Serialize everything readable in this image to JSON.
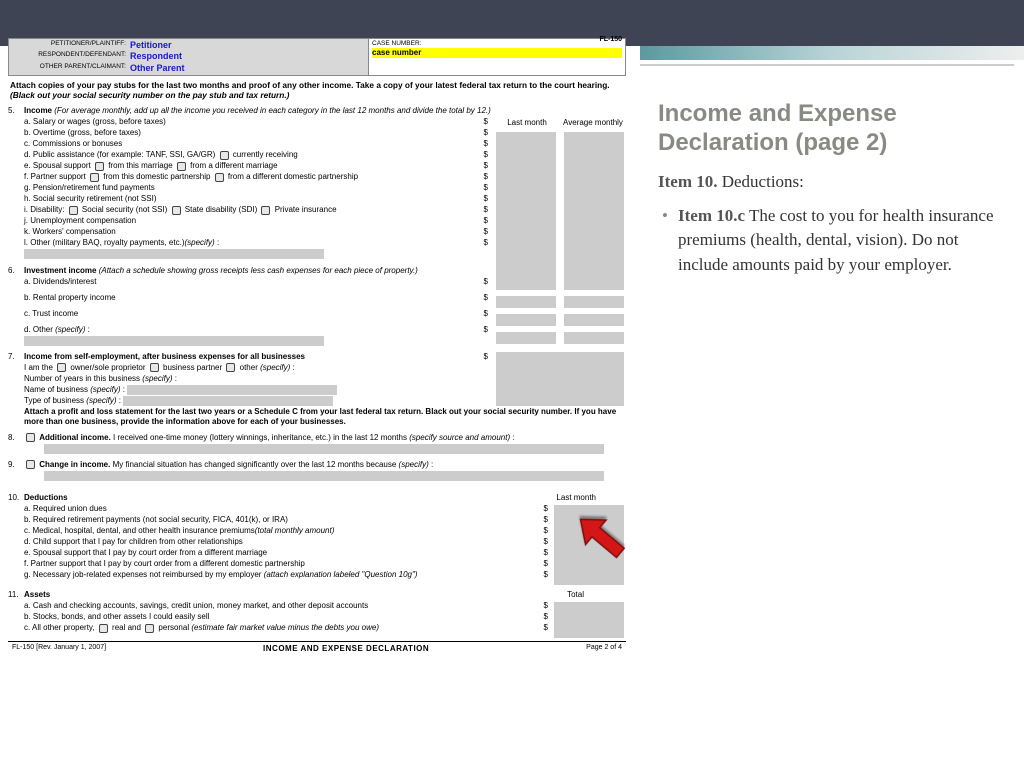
{
  "form_code": "FL-150",
  "header": {
    "pet_label": "PETITIONER/PLAINTIFF:",
    "pet_val": "Petitioner",
    "resp_label": "RESPONDENT/DEFENDANT:",
    "resp_val": "Respondent",
    "other_label": "OTHER PARENT/CLAIMANT:",
    "other_val": "Other Parent",
    "case_label": "CASE NUMBER:",
    "case_val": "case number"
  },
  "instr": "Attach copies of your pay stubs for the last two months and proof of any other income. Take a copy of your latest federal tax return to the court hearing.",
  "instr_em": "(Black out your social security number on the pay stub and tax return.)",
  "col_last": "Last month",
  "col_avg": "Average monthly",
  "s5": {
    "num": "5.",
    "title": "Income",
    "note": "(For average monthly, add up all the income you received in each category in the last 12 months and divide the total by 12.)",
    "a": "a.  Salary or wages (gross, before taxes)",
    "b": "b.  Overtime (gross, before taxes)",
    "c": "c.  Commissions or bonuses",
    "d": "d.  Public assistance (for example: TANF, SSI, GA/GR)",
    "d_opt": "currently receiving",
    "e": "e.  Spousal support",
    "e1": "from this marriage",
    "e2": "from a different marriage",
    "f": "f.   Partner support",
    "f1": "from this domestic partnership",
    "f2": "from a different domestic partnership",
    "g": "g.  Pension/retirement fund payments",
    "h": "h.  Social security retirement (not SSI)",
    "i": "i.   Disability:",
    "i1": "Social security (not SSI)",
    "i2": "State disability (SDI)",
    "i3": "Private insurance",
    "j": "j.   Unemployment compensation",
    "k": "k.  Workers' compensation",
    "l": "l.   Other (military BAQ, royalty payments, etc.)",
    "spec": "(specify)"
  },
  "s6": {
    "num": "6.",
    "title": "Investment income",
    "note": "(Attach a schedule showing gross receipts less cash expenses for each piece of property.)",
    "a": "a.  Dividends/interest",
    "b": "b.  Rental property income",
    "c": "c.  Trust income",
    "d": "d.  Other",
    "spec": "(specify)"
  },
  "s7": {
    "num": "7.",
    "title": "Income from self-employment, after business expenses for all businesses",
    "iam": "I am the",
    "o1": "owner/sole proprietor",
    "o2": "business partner",
    "o3": "other",
    "spec": "(specify)",
    "yrs": "Number of years in this business",
    "name": "Name of business",
    "type": "Type of business",
    "attach": "Attach a profit and loss statement for the last two years or a Schedule C from your last federal tax return. Black out your social security number. If you have more than one business, provide the information above for each of your businesses."
  },
  "s8": {
    "num": "8.",
    "title": "Additional income.",
    "txt": "I received one-time money (lottery winnings, inheritance, etc.) in the last 12 months",
    "spec": "(specify source and amount)"
  },
  "s9": {
    "num": "9.",
    "title": "Change in income.",
    "txt": "My financial situation has changed significantly over the last 12 months because",
    "spec": "(specify)"
  },
  "s10": {
    "num": "10.",
    "title": "Deductions",
    "col": "Last month",
    "a": "a.  Required union dues",
    "b": "b.  Required retirement payments (not social security, FICA, 401(k), or IRA)",
    "c": "c.  Medical, hospital, dental, and other health insurance premiums",
    "c_em": "(total monthly amount)",
    "d": "d.  Child support that I pay for children from other relationships",
    "e": "e.  Spousal support that I pay by court order from a different marriage",
    "f": "f.   Partner support that I pay by court order from a different domestic partnership",
    "g": "g.  Necessary job-related expenses not reimbursed by my employer",
    "g_em": "(attach explanation labeled \"Question 10g\")"
  },
  "s11": {
    "num": "11.",
    "title": "Assets",
    "col": "Total",
    "a": "a.  Cash and checking accounts, savings, credit union, money market, and other deposit accounts",
    "b": "b.  Stocks, bonds, and other assets I could easily sell",
    "c": "c.  All other property,",
    "c1": "real and",
    "c2": "personal",
    "c_em": "(estimate fair market value minus the debts you owe)"
  },
  "footer": {
    "left": "FL-150 [Rev. January 1, 2007]",
    "mid": "INCOME AND EXPENSE DECLARATION",
    "right": "Page 2 of 4"
  },
  "slide": {
    "title": "Income and Expense Declaration (page 2)",
    "line1a": "Item 10.",
    "line1b": "  Deductions:",
    "bullet_b": "Item 10.c",
    "bullet_t": "  The cost to you for health insurance premiums (health, dental, vision).  Do not include amounts paid by your employer."
  }
}
